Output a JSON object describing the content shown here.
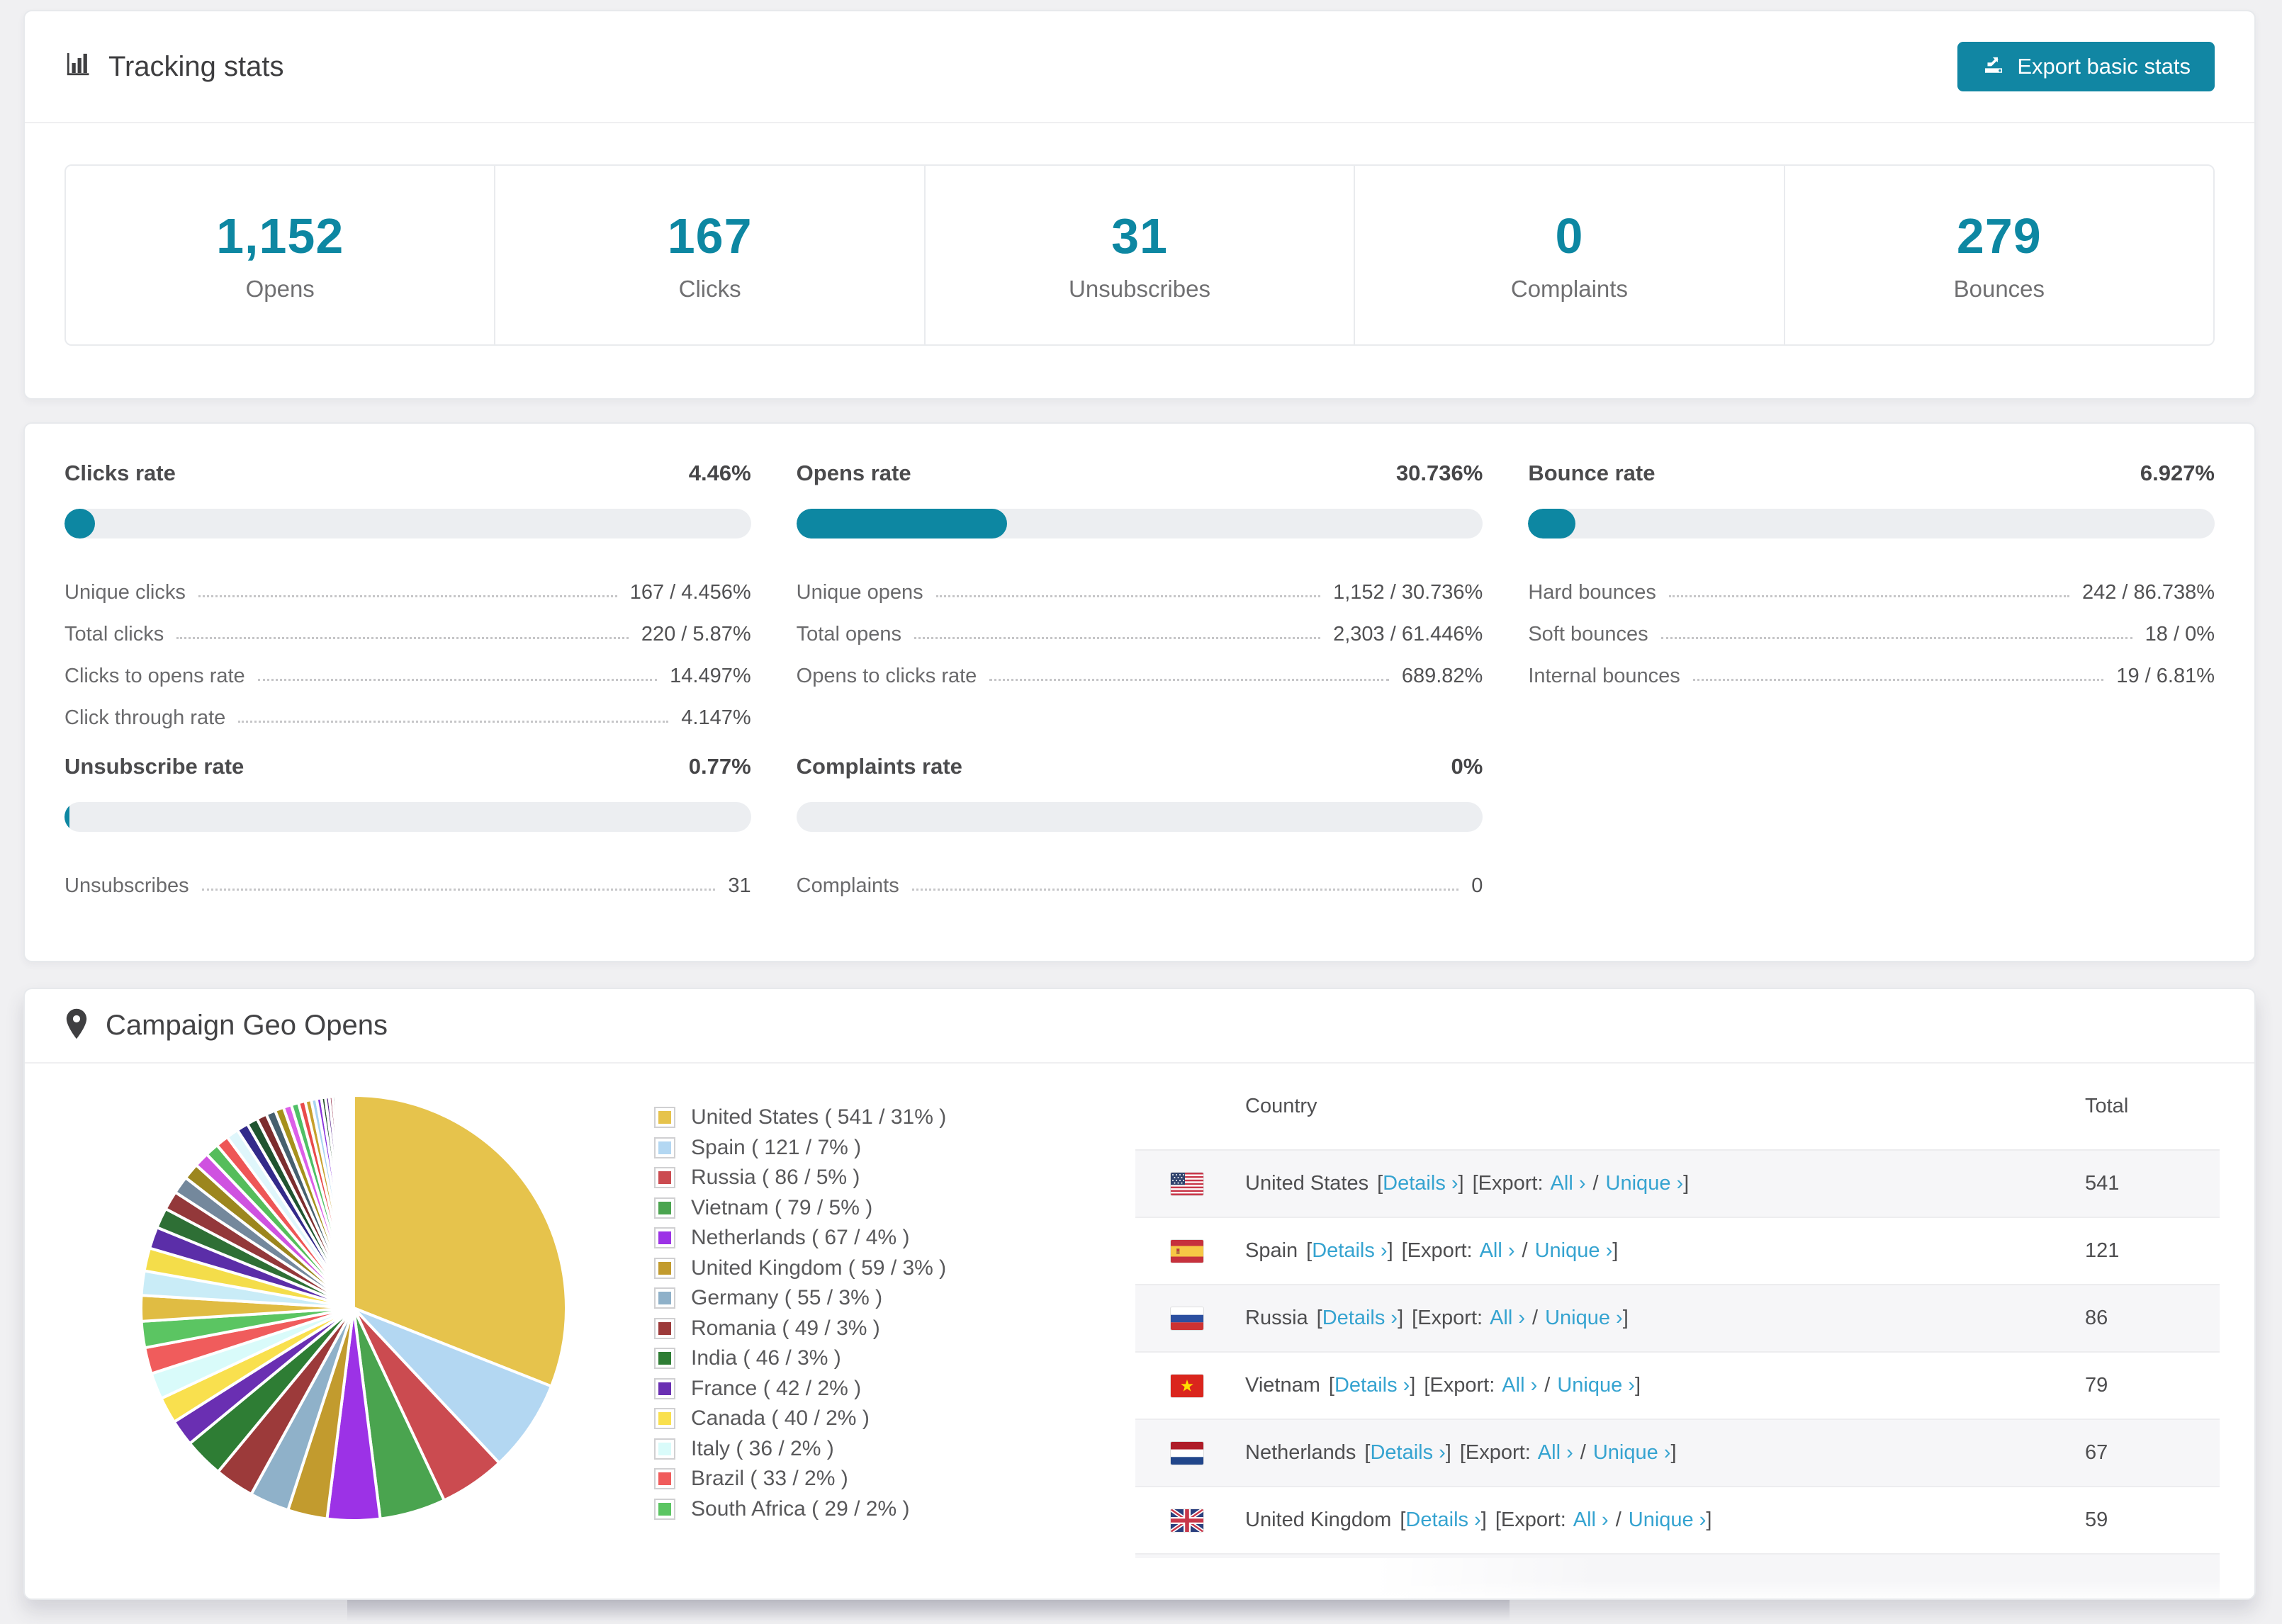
{
  "colors": {
    "accent": "#0d87a2",
    "button": "#1186a3",
    "link": "#35a3d0",
    "bar_track": "#eceef1"
  },
  "header": {
    "title": "Tracking stats",
    "export_label": "Export basic stats"
  },
  "summary": [
    {
      "value": "1,152",
      "label": "Opens"
    },
    {
      "value": "167",
      "label": "Clicks"
    },
    {
      "value": "31",
      "label": "Unsubscribes"
    },
    {
      "value": "0",
      "label": "Complaints"
    },
    {
      "value": "279",
      "label": "Bounces"
    }
  ],
  "rates": [
    {
      "title": "Clicks rate",
      "value": "4.46%",
      "percent": 4.46,
      "rows": [
        {
          "label": "Unique clicks",
          "value": "167 / 4.456%"
        },
        {
          "label": "Total clicks",
          "value": "220 / 5.87%"
        },
        {
          "label": "Clicks to opens rate",
          "value": "14.497%"
        },
        {
          "label": "Click through rate",
          "value": "4.147%"
        }
      ]
    },
    {
      "title": "Opens rate",
      "value": "30.736%",
      "percent": 30.736,
      "rows": [
        {
          "label": "Unique opens",
          "value": "1,152 / 30.736%"
        },
        {
          "label": "Total opens",
          "value": "2,303 / 61.446%"
        },
        {
          "label": "Opens to clicks rate",
          "value": "689.82%"
        }
      ]
    },
    {
      "title": "Bounce rate",
      "value": "6.927%",
      "percent": 6.927,
      "rows": [
        {
          "label": "Hard bounces",
          "value": "242 / 86.738%"
        },
        {
          "label": "Soft bounces",
          "value": "18 / 0%"
        },
        {
          "label": "Internal bounces",
          "value": "19 / 6.81%"
        }
      ]
    },
    {
      "title": "Unsubscribe rate",
      "value": "0.77%",
      "percent": 0.77,
      "rows": [
        {
          "label": "Unsubscribes",
          "value": "31"
        }
      ]
    },
    {
      "title": "Complaints rate",
      "value": "0%",
      "percent": 0,
      "rows": [
        {
          "label": "Complaints",
          "value": "0"
        }
      ]
    }
  ],
  "geo": {
    "title": "Campaign Geo Opens",
    "legend": [
      {
        "label": "United States ( 541 / 31% )",
        "color": "#e6c34c"
      },
      {
        "label": "Spain ( 121 / 7% )",
        "color": "#b3d7f2"
      },
      {
        "label": "Russia ( 86 / 5% )",
        "color": "#cb4b50"
      },
      {
        "label": "Vietnam ( 79 / 5% )",
        "color": "#4aa44f"
      },
      {
        "label": "Netherlands ( 67 / 4% )",
        "color": "#9c32e6"
      },
      {
        "label": "United Kingdom ( 59 / 3% )",
        "color": "#c29b2e"
      },
      {
        "label": "Germany ( 55 / 3% )",
        "color": "#8fb1c9"
      },
      {
        "label": "Romania ( 49 / 3% )",
        "color": "#9c3a3a"
      },
      {
        "label": "India ( 46 / 3% )",
        "color": "#2e7d34"
      },
      {
        "label": "France ( 42 / 2% )",
        "color": "#6a2fb2"
      },
      {
        "label": "Canada ( 40 / 2% )",
        "color": "#f9e04e"
      },
      {
        "label": "Italy ( 36 / 2% )",
        "color": "#d9fbfa"
      },
      {
        "label": "Brazil ( 33 / 2% )",
        "color": "#f05c5c"
      },
      {
        "label": "South Africa ( 29 / 2% )",
        "color": "#5bc562"
      }
    ],
    "table": {
      "columns": {
        "country": "Country",
        "total": "Total"
      },
      "syntax": {
        "lb": "[",
        "rb": "]",
        "export_prefix": "[Export:",
        "slash": "/",
        "details": "Details ›",
        "all": "All ›",
        "unique": "Unique ›"
      },
      "rows": [
        {
          "country": "United States",
          "total": "541",
          "flag": "us"
        },
        {
          "country": "Spain",
          "total": "121",
          "flag": "es"
        },
        {
          "country": "Russia",
          "total": "86",
          "flag": "ru"
        },
        {
          "country": "Vietnam",
          "total": "79",
          "flag": "vn"
        },
        {
          "country": "Netherlands",
          "total": "67",
          "flag": "nl"
        },
        {
          "country": "United Kingdom",
          "total": "59",
          "flag": "gb"
        },
        {
          "country": "",
          "total": "",
          "flag": "de"
        }
      ]
    }
  },
  "chart_data": {
    "type": "pie",
    "title": "Campaign Geo Opens",
    "unit": "opens",
    "start_angle_deg": -90,
    "direction": "clockwise",
    "slices": [
      {
        "label": "United States",
        "value": 541,
        "percent": 31,
        "color": "#e6c34c"
      },
      {
        "label": "Spain",
        "value": 121,
        "percent": 7,
        "color": "#b3d7f2"
      },
      {
        "label": "Russia",
        "value": 86,
        "percent": 5,
        "color": "#cb4b50"
      },
      {
        "label": "Vietnam",
        "value": 79,
        "percent": 5,
        "color": "#4aa44f"
      },
      {
        "label": "Netherlands",
        "value": 67,
        "percent": 4,
        "color": "#9c32e6"
      },
      {
        "label": "United Kingdom",
        "value": 59,
        "percent": 3,
        "color": "#c29b2e"
      },
      {
        "label": "Germany",
        "value": 55,
        "percent": 3,
        "color": "#8fb1c9"
      },
      {
        "label": "Romania",
        "value": 49,
        "percent": 3,
        "color": "#9c3a3a"
      },
      {
        "label": "India",
        "value": 46,
        "percent": 3,
        "color": "#2e7d34"
      },
      {
        "label": "France",
        "value": 42,
        "percent": 2,
        "color": "#6a2fb2"
      },
      {
        "label": "Canada",
        "value": 40,
        "percent": 2,
        "color": "#f9e04e"
      },
      {
        "label": "Italy",
        "value": 36,
        "percent": 2,
        "color": "#d9fbfa"
      },
      {
        "label": "Brazil",
        "value": 33,
        "percent": 2,
        "color": "#f05c5c"
      },
      {
        "label": "South Africa",
        "value": 29,
        "percent": 2,
        "color": "#5bc562"
      }
    ],
    "other_slices": [
      1.9,
      1.8,
      1.7,
      1.6,
      1.5,
      1.4,
      1.3,
      1.2,
      1.1,
      1.0,
      0.95,
      0.9,
      0.85,
      0.8,
      0.75,
      0.7,
      0.65,
      0.6,
      0.55,
      0.5,
      0.45,
      0.4,
      0.35,
      0.3,
      0.28,
      0.25,
      0.22,
      0.2,
      0.18,
      0.15,
      0.13,
      0.12,
      0.1,
      0.09,
      0.08,
      0.07,
      0.06,
      0.05,
      0.05,
      0.04
    ],
    "other_palette": [
      "#e0bc43",
      "#c9ecf7",
      "#f4dd4a",
      "#5b2ea8",
      "#2e6f35",
      "#93383a",
      "#74889c",
      "#9c861e",
      "#cf52e0",
      "#55bd5b",
      "#ee5656",
      "#dff6fb",
      "#332a8a",
      "#1f5430",
      "#7c2d2e",
      "#46606e",
      "#a6911c",
      "#dc5fe8",
      "#4fbf66",
      "#e94b4b",
      "#c7a02c",
      "#a9d4f0",
      "#8833dd",
      "#224d2b",
      "#531f86",
      "#8a1f3c",
      "#0f3b2e",
      "#27276e"
    ]
  }
}
